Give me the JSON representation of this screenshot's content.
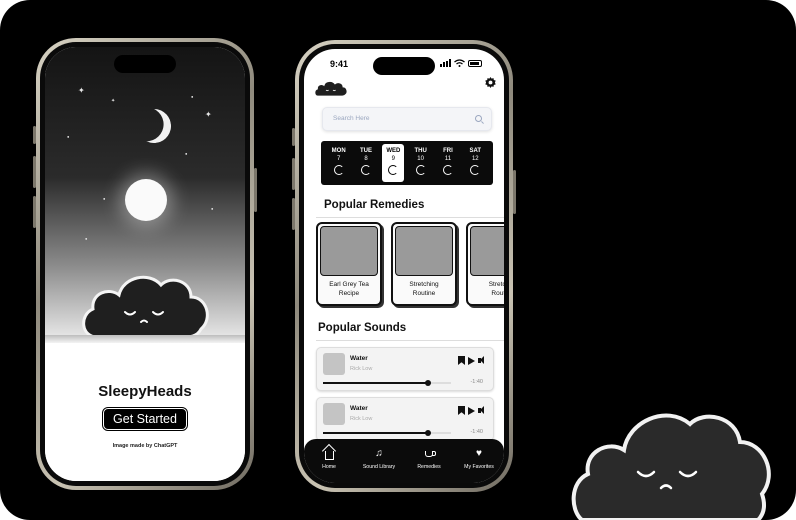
{
  "splash": {
    "app_name": "SleepyHeads",
    "cta_label": "Get Started",
    "credit": "Image made by ChatGPT"
  },
  "status_bar": {
    "time": "9:41"
  },
  "search": {
    "placeholder": "Search Here"
  },
  "week": {
    "days": [
      {
        "name": "MON",
        "date": "7"
      },
      {
        "name": "TUE",
        "date": "8"
      },
      {
        "name": "WED",
        "date": "9",
        "active": true
      },
      {
        "name": "THU",
        "date": "10"
      },
      {
        "name": "FRI",
        "date": "11"
      },
      {
        "name": "SAT",
        "date": "12"
      }
    ]
  },
  "remedies": {
    "title": "Popular Remedies",
    "items": [
      {
        "line1": "Earl Grey Tea",
        "line2": "Recipe"
      },
      {
        "line1": "Stretching",
        "line2": "Routine"
      },
      {
        "line1": "Stretch",
        "line2": "Routi"
      }
    ]
  },
  "sounds": {
    "title": "Popular Sounds",
    "items": [
      {
        "name": "Water",
        "artist": "Rick Low",
        "remaining": "-1:40",
        "progress": 0.82
      },
      {
        "name": "Water",
        "artist": "Rick Low",
        "remaining": "-1:40",
        "progress": 0.82
      }
    ]
  },
  "tabbar": {
    "items": [
      {
        "label": "Home",
        "icon": "home-icon"
      },
      {
        "label": "Sound Library",
        "icon": "music-note-icon"
      },
      {
        "label": "Remedies",
        "icon": "tea-cup-icon"
      },
      {
        "label": "My Favorites",
        "icon": "heart-icon"
      }
    ]
  },
  "colors": {
    "background": "#000000",
    "card_gray": "#9a9a9a",
    "placeholder": "#9aa6bf"
  }
}
